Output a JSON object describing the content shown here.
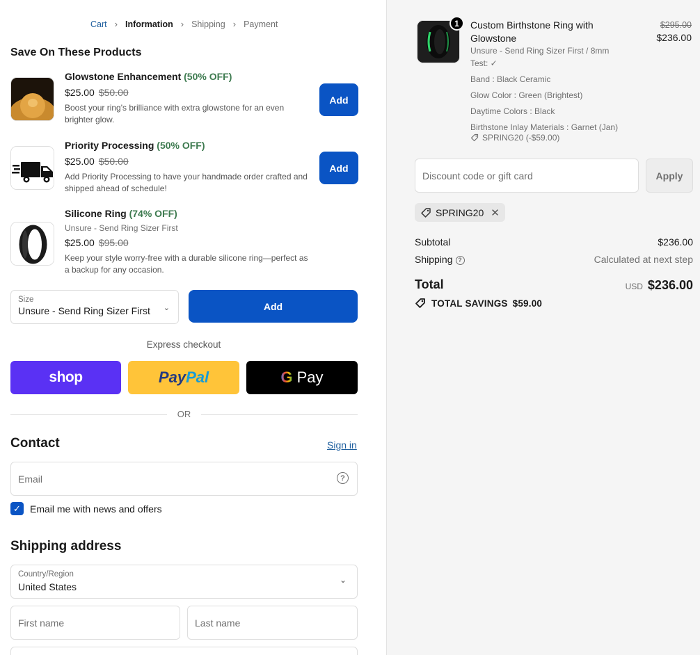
{
  "breadcrumb": {
    "items": [
      {
        "label": "Cart",
        "state": "link"
      },
      {
        "label": "Information",
        "state": "active"
      },
      {
        "label": "Shipping",
        "state": "inactive"
      },
      {
        "label": "Payment",
        "state": "inactive"
      }
    ],
    "separator": "chevron-right-icon"
  },
  "upsell": {
    "heading": "Save On These Products",
    "items": [
      {
        "name": "Glowstone Enhancement",
        "discount": "(50% OFF)",
        "price": "$25.00",
        "compare_price": "$50.00",
        "description": "Boost your ring's brilliance with extra glowstone for an even brighter glow.",
        "button": "Add"
      },
      {
        "name": "Priority Processing",
        "discount": "(50% OFF)",
        "price": "$25.00",
        "compare_price": "$50.00",
        "description": "Add Priority Processing to have your handmade order crafted and shipped ahead of schedule!",
        "button": "Add"
      },
      {
        "name": "Silicone Ring",
        "discount": "(74% OFF)",
        "variant": "Unsure - Send Ring Sizer First",
        "price": "$25.00",
        "compare_price": "$95.00",
        "description": "Keep your style worry-free with a durable silicone ring—perfect as a backup for any occasion.",
        "size_label": "Size",
        "size_value": "Unsure - Send Ring Sizer First",
        "button": "Add"
      }
    ]
  },
  "express": {
    "title": "Express checkout",
    "shop_label": "shop",
    "paypal_label_1": "Pay",
    "paypal_label_2": "Pal",
    "gpay_g": "G",
    "gpay_label": "Pay",
    "or_label": "OR"
  },
  "contact": {
    "heading": "Contact",
    "signin": "Sign in",
    "email_placeholder": "Email",
    "newsletter_label": "Email me with news and offers",
    "newsletter_checked": true
  },
  "shipping": {
    "heading": "Shipping address",
    "country_label": "Country/Region",
    "country_value": "United States",
    "first_name_placeholder": "First name",
    "last_name_placeholder": "Last name"
  },
  "order": {
    "item": {
      "quantity": "1",
      "name": "Custom Birthstone Ring with Glowstone",
      "compare_price": "$295.00",
      "price": "$236.00",
      "variant": "Unsure - Send Ring Sizer First / 8mm",
      "test": "Test: ✓",
      "band": "Band : Black Ceramic",
      "glow": "Glow Color : Green (Brightest)",
      "daytime": "Daytime Colors : Black",
      "inlay": "Birthstone Inlay Materials : Garnet (Jan)",
      "discount": "SPRING20 (-$59.00)"
    },
    "discount_placeholder": "Discount code or gift card",
    "apply": "Apply",
    "applied_code": "SPRING20",
    "subtotal_label": "Subtotal",
    "subtotal_value": "$236.00",
    "shipping_label": "Shipping",
    "shipping_value": "Calculated at next step",
    "total_label": "Total",
    "currency": "USD",
    "total_value": "$236.00",
    "savings_label": "TOTAL SAVINGS",
    "savings_value": "$59.00"
  },
  "colors": {
    "primary_button": "#0a54c4",
    "discount_green": "#3d7a4f",
    "shop_purple": "#5a31f4",
    "paypal_yellow": "#ffc439",
    "link_blue": "#1f5f9e"
  }
}
